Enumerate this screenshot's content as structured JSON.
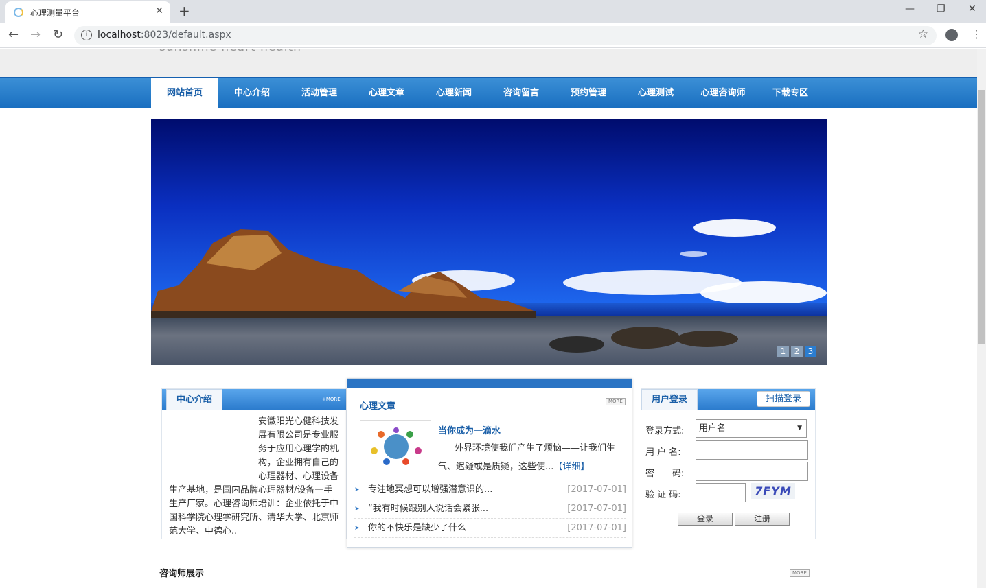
{
  "browser": {
    "tab_title": "心理测量平台",
    "new_tab_symbol": "+",
    "close_symbol": "✕",
    "url_host": "localhost",
    "url_path": ":8023/default.aspx",
    "minimize_symbol": "—",
    "restore_symbol": "❐",
    "close_window_symbol": "✕"
  },
  "header": {
    "slogan": "sunshine heart health"
  },
  "nav": {
    "items": [
      {
        "label": "网站首页"
      },
      {
        "label": "中心介绍"
      },
      {
        "label": "活动管理"
      },
      {
        "label": "心理文章"
      },
      {
        "label": "心理新闻"
      },
      {
        "label": "咨询留言"
      },
      {
        "label": "预约管理"
      },
      {
        "label": "心理测试"
      },
      {
        "label": "心理咨询师"
      },
      {
        "label": "下载专区"
      }
    ],
    "active_index": 0
  },
  "banner": {
    "slides": [
      "1",
      "2",
      "3"
    ],
    "current": 3
  },
  "intro": {
    "title": "中心介绍",
    "more": "+MORE",
    "text": "安徽阳光心健科技发展有限公司是专业服务于应用心理学的机构，企业拥有自己的心理器材、心理设备生产基地，是国内品牌心理器材/设备一手生产厂家。心理咨询师培训：企业依托于中国科学院心理学研究所、清华大学、北京师范大学、中德心.."
  },
  "articles": {
    "title": "心理文章",
    "more": "MORE",
    "feature": {
      "title": "当你成为一滴水",
      "text": "外界环境使我们产生了烦恼——让我们生气、迟疑或是质疑，这些使...",
      "detail_label": "【详细】"
    },
    "list": [
      {
        "title": "专注地冥想可以增强潜意识的...",
        "date": "[2017-07-01]"
      },
      {
        "title": "“我有时候跟别人说话会紧张...",
        "date": "[2017-07-01]"
      },
      {
        "title": "你的不快乐是缺少了什么",
        "date": "[2017-07-01]"
      }
    ]
  },
  "login": {
    "title": "用户登录",
    "scan_label": "扫描登录",
    "method_label": "登录方式:",
    "method_value": "用户名",
    "username_label": "用 户 名:",
    "password_label": "密　　码:",
    "captcha_label": "验 证 码:",
    "captcha_text": "7FYM",
    "login_button": "登录",
    "register_button": "注册"
  },
  "counselors": {
    "title": "咨询师展示",
    "more": "MORE"
  },
  "colors": {
    "nav_blue": "#1a6fc0",
    "link_blue": "#1a5fa8"
  }
}
